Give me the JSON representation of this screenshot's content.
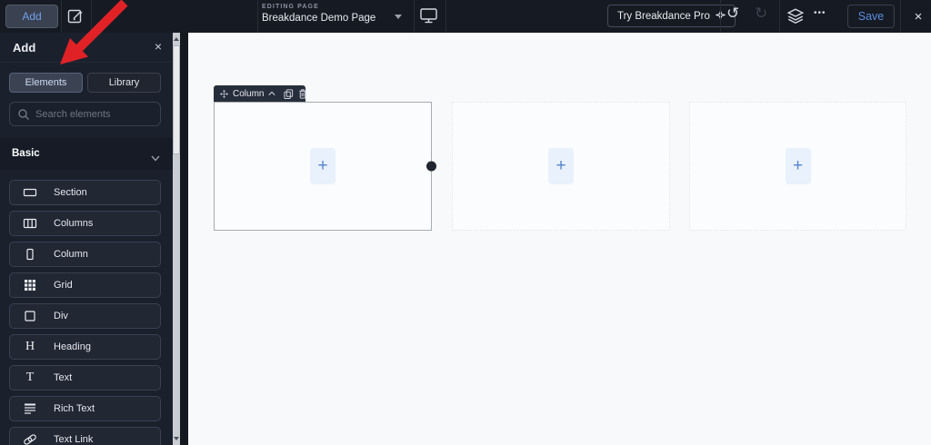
{
  "topbar": {
    "add_button": "Add",
    "editing_label": "EDITING PAGE",
    "page_title": "Breakdance Demo Page",
    "try_pro_button": "Try Breakdance Pro",
    "save_button": "Save"
  },
  "sidebar": {
    "panel_title": "Add",
    "tabs": [
      {
        "label": "Elements",
        "active": true
      },
      {
        "label": "Library",
        "active": false
      }
    ],
    "search_placeholder": "Search elements",
    "section_header": "Basic",
    "elements": [
      {
        "label": "Section",
        "icon": "section-icon"
      },
      {
        "label": "Columns",
        "icon": "columns-icon"
      },
      {
        "label": "Column",
        "icon": "column-icon"
      },
      {
        "label": "Grid",
        "icon": "grid-icon"
      },
      {
        "label": "Div",
        "icon": "div-icon"
      },
      {
        "label": "Heading",
        "icon": "heading-icon"
      },
      {
        "label": "Text",
        "icon": "text-icon"
      },
      {
        "label": "Rich Text",
        "icon": "rich-text-icon"
      },
      {
        "label": "Text Link",
        "icon": "text-link-icon"
      }
    ]
  },
  "canvas": {
    "selected_badge_label": "Column",
    "columns_count": 3
  },
  "icons": {
    "close": "×",
    "undo": "↺",
    "redo": "↻",
    "ellipsis": "•••",
    "heading_glyph": "H",
    "text_glyph": "T",
    "plus": "+"
  },
  "annotation": {
    "type": "red-arrow",
    "points_to": "Elements tab",
    "color": "#e02227"
  },
  "colors": {
    "accent_blue": "#5585cd",
    "save_text": "#5a8edc",
    "topbar_bg": "#161a23",
    "sidebar_bg": "#1b212c",
    "canvas_bg": "#f8f9fb",
    "arrow_red": "#e02227",
    "plus_tile_bg": "#e9f1fc"
  }
}
